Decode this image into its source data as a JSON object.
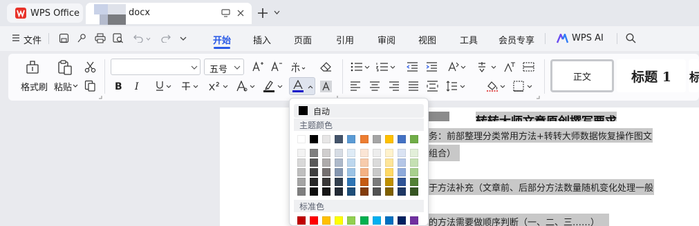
{
  "titlebar": {
    "app_tab": "WPS Office",
    "doc_tab": "docx"
  },
  "menu": {
    "file": "文件",
    "tabs": [
      "开始",
      "插入",
      "页面",
      "引用",
      "审阅",
      "视图",
      "工具",
      "会员专享"
    ],
    "ai": "WPS AI"
  },
  "toolbar": {
    "format_painter": "格式刷",
    "paste": "粘贴",
    "font_name_value": "",
    "font_size_value": "五号",
    "style_normal": "正文",
    "style_heading1": "标题 1",
    "style_heading2_partial": "标"
  },
  "color_popup": {
    "auto_label": "自动",
    "theme_label": "主题颜色",
    "standard_label": "标准色",
    "theme_top": [
      "#ffffff",
      "#000000",
      "#e7e6e6",
      "#44546a",
      "#5b9bd5",
      "#ed7d31",
      "#a5a5a5",
      "#ffc000",
      "#4472c4",
      "#70ad47"
    ],
    "theme_shades": [
      [
        "#f2f2f2",
        "#7f7f7f",
        "#d0cece",
        "#d6dce4",
        "#deebf6",
        "#fbe5d5",
        "#ededed",
        "#fff2cc",
        "#dae3f3",
        "#e2efd9"
      ],
      [
        "#d8d8d8",
        "#595959",
        "#aeabab",
        "#adb9ca",
        "#bdd7ee",
        "#f7cbac",
        "#dbdbdb",
        "#fee599",
        "#b4c6e7",
        "#c5e0b3"
      ],
      [
        "#bfbfbf",
        "#3f3f3f",
        "#757070",
        "#8496b0",
        "#9cc3e5",
        "#f4b183",
        "#c9c9c9",
        "#ffd965",
        "#8eaadb",
        "#a8d08d"
      ],
      [
        "#a5a5a5",
        "#262626",
        "#3a3838",
        "#323f4f",
        "#2e75b5",
        "#c55a11",
        "#7b7b7b",
        "#bf9000",
        "#2f5496",
        "#538135"
      ],
      [
        "#7f7f7f",
        "#0c0c0c",
        "#171616",
        "#222a35",
        "#1e4e79",
        "#833c0b",
        "#525252",
        "#7f6000",
        "#1f3864",
        "#375623"
      ]
    ],
    "standard": [
      "#c00000",
      "#ff0000",
      "#ffc000",
      "#ffff00",
      "#92d050",
      "#00b050",
      "#00b0f0",
      "#0070c0",
      "#002060",
      "#7030a0"
    ]
  },
  "document": {
    "line1": "转转大师文章原创撰写要求",
    "line2a": "务：前部整理分类常用方法+转转大师数据恢复操作图文",
    "line2b": "组合）",
    "line3": "于方法补充（文章前、后部分方法数量随机变化处理一般",
    "line4": "的方法需要做顺序判断（一、二、三……）"
  }
}
